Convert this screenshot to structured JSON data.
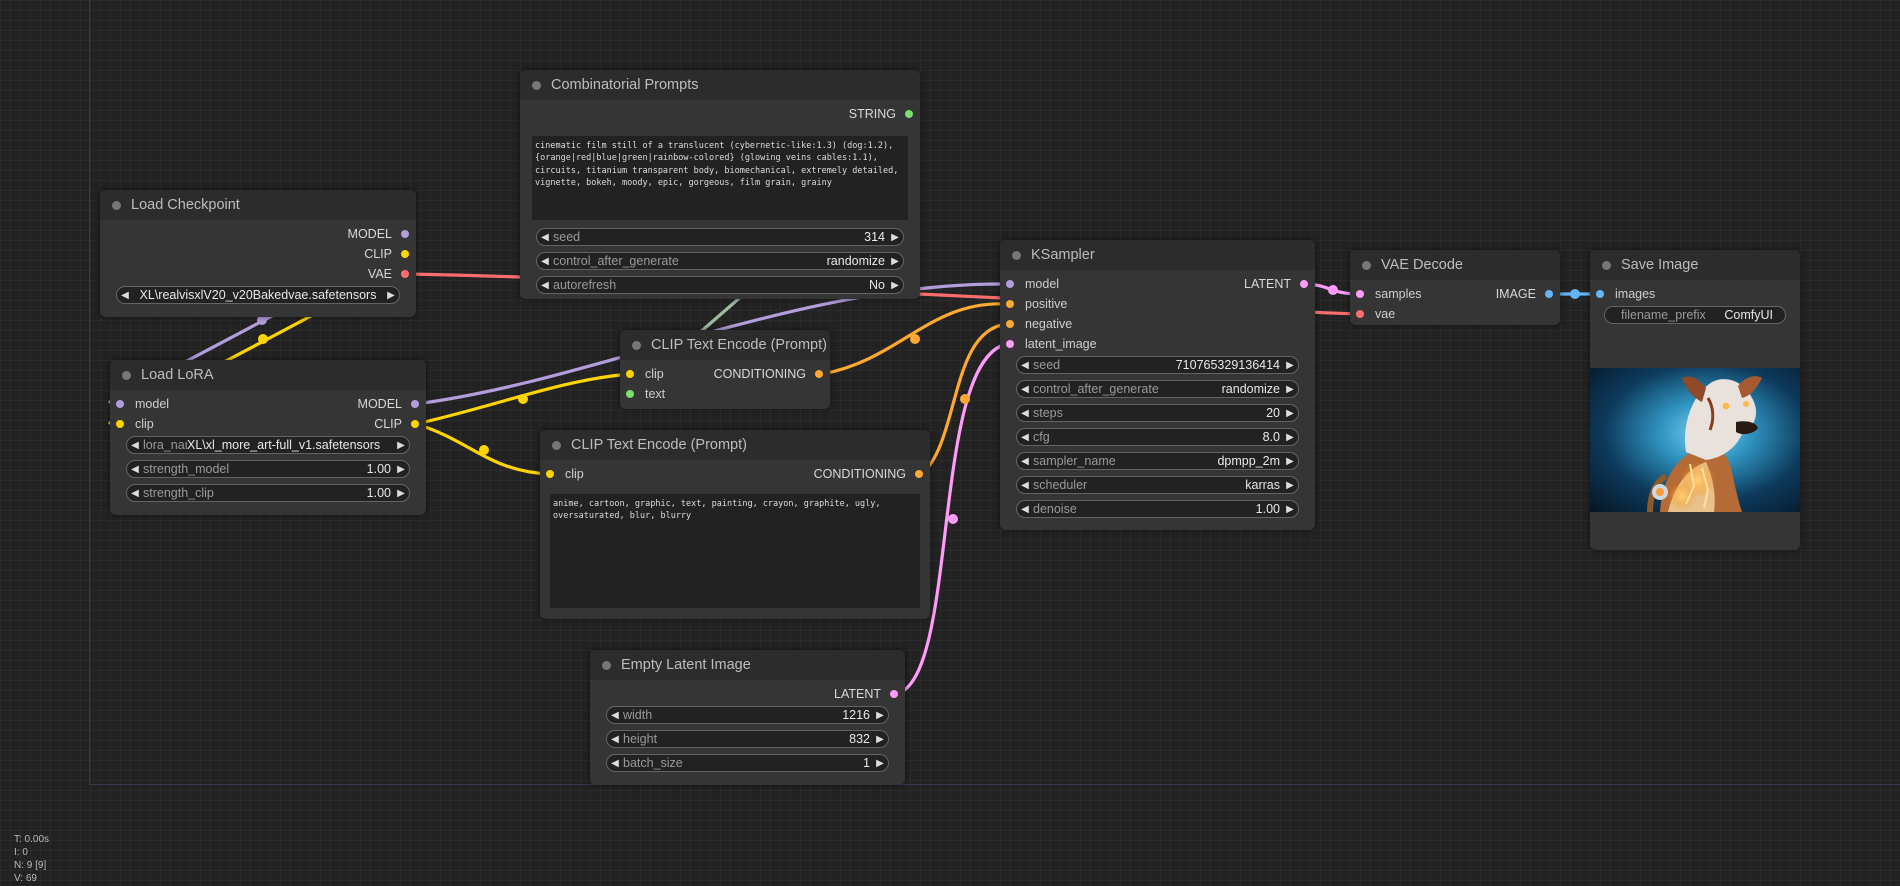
{
  "colors": {
    "model": "#b39ddb",
    "clip": "#ffd500",
    "vae": "#ff6e6e",
    "string": "#7cde6e",
    "conditioning": "#ffa931",
    "latent": "#ff9cf9",
    "image": "#64b5f6"
  },
  "nodes": {
    "load_checkpoint": {
      "title": "Load Checkpoint",
      "outputs": [
        "MODEL",
        "CLIP",
        "VAE"
      ],
      "ckpt_name": "XL\\realvisxlV20_v20Bakedvae.safetensors"
    },
    "load_lora": {
      "title": "Load LoRA",
      "inputs": [
        "model",
        "clip"
      ],
      "outputs": [
        "MODEL",
        "CLIP"
      ],
      "lora_name_label": "lora_nar",
      "lora_name": "XL\\xl_more_art-full_v1.safetensors",
      "strength_model_label": "strength_model",
      "strength_model": "1.00",
      "strength_clip_label": "strength_clip",
      "strength_clip": "1.00"
    },
    "combinatorial_prompts": {
      "title": "Combinatorial Prompts",
      "output": "STRING",
      "text": "cinematic film still of a translucent (cybernetic-like:1.3) (dog:1.2), {orange|red|blue|green|rainbow-colored} (glowing veins cables:1.1), circuits, titanium transparent body, biomechanical, extremely detailed, vignette, bokeh, moody, epic, gorgeous, film grain, grainy",
      "seed_label": "seed",
      "seed": "314",
      "control_label": "control_after_generate",
      "control": "randomize",
      "autorefresh_label": "autorefresh",
      "autorefresh": "No"
    },
    "clip_text_encode_pos": {
      "title": "CLIP Text Encode (Prompt)",
      "inputs": [
        "clip",
        "text"
      ],
      "output": "CONDITIONING"
    },
    "clip_text_encode_neg": {
      "title": "CLIP Text Encode (Prompt)",
      "input": "clip",
      "output": "CONDITIONING",
      "text": "anime, cartoon, graphic, text, painting, crayon, graphite, ugly, oversaturated, blur, blurry"
    },
    "empty_latent": {
      "title": "Empty Latent Image",
      "output": "LATENT",
      "width_label": "width",
      "width": "1216",
      "height_label": "height",
      "height": "832",
      "batch_label": "batch_size",
      "batch_size": "1"
    },
    "ksampler": {
      "title": "KSampler",
      "inputs": [
        "model",
        "positive",
        "negative",
        "latent_image"
      ],
      "output": "LATENT",
      "widgets": [
        {
          "label": "seed",
          "value": "710765329136414"
        },
        {
          "label": "control_after_generate",
          "value": "randomize"
        },
        {
          "label": "steps",
          "value": "20"
        },
        {
          "label": "cfg",
          "value": "8.0"
        },
        {
          "label": "sampler_name",
          "value": "dpmpp_2m"
        },
        {
          "label": "scheduler",
          "value": "karras"
        },
        {
          "label": "denoise",
          "value": "1.00"
        }
      ]
    },
    "vae_decode": {
      "title": "VAE Decode",
      "inputs": [
        "samples",
        "vae"
      ],
      "output": "IMAGE"
    },
    "save_image": {
      "title": "Save Image",
      "input": "images",
      "filename_prefix_label": "filename_prefix",
      "filename_prefix": "ComfyUI"
    }
  },
  "stats": [
    "T: 0.00s",
    "I: 0",
    "N: 9 [9]",
    "V: 69"
  ]
}
